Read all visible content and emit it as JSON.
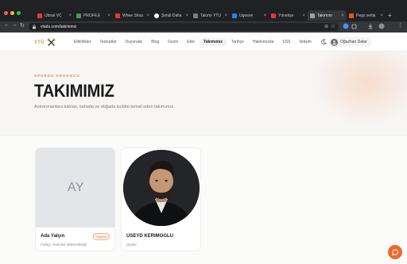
{
  "browser": {
    "tabs": [
      {
        "title": "Ubrak VC",
        "favicon_color": "#e53935"
      },
      {
        "title": "PROFİLE",
        "favicon_color": "#43a047"
      },
      {
        "title": "Whee Shou",
        "favicon_color": "#e53935"
      },
      {
        "title": "Şimdi Dalla",
        "favicon_color": "#111111"
      },
      {
        "title": "Takımı YTÜ",
        "favicon_color": "#7e7e7e"
      },
      {
        "title": "Ugwaré",
        "favicon_color": "#1e88e5"
      },
      {
        "title": "Yönetişe",
        "favicon_color": "#e53935"
      },
      {
        "title": "Takımım",
        "favicon_color": "#9e9e9e",
        "active": true
      },
      {
        "title": "Pegs setila",
        "favicon_color": "#f4511e"
      }
    ],
    "url": "vtadu.com/takimimiz",
    "window_dots": [
      "#ff5f57",
      "#febc2e",
      "#28c840"
    ]
  },
  "site": {
    "logo_text": "YTÜ",
    "nav": [
      "Etkinlikler",
      "Tesisatlar",
      "Duyurular",
      "Blog",
      "Gezin",
      "Ekle",
      "Takımımız",
      "Tarihçe",
      "Hakkımızda",
      "SSS",
      "İletişim"
    ],
    "nav_active": "Takımımız",
    "user_name": "Oğuzhan Dalar"
  },
  "hero": {
    "eyebrow": "SPORDU KROHOCU",
    "title": "TAKIMIMIZ",
    "description": "Antrenmanlara katılan, sahada ve doğada kulübü temsil eden takımımız."
  },
  "team": [
    {
      "initials": "AY",
      "name": "Ada Yalçın",
      "role": "Fizikçi, Patronik Mühendisliği",
      "badge": "Kaptan",
      "has_photo": false
    },
    {
      "initials": "",
      "name": "USEYD KERIMOGLU",
      "role": "Üyeler",
      "badge": "",
      "has_photo": true
    }
  ],
  "colors": {
    "accent": "#e0884f",
    "fab": "#ea6b2d",
    "logo_gold": "#c9a23a"
  }
}
